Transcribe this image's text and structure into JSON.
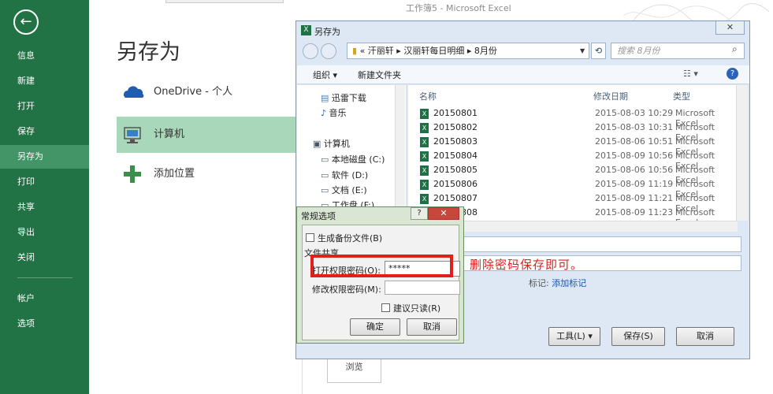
{
  "window_title": "工作簿5 - Microsoft Excel",
  "backstage": {
    "back_arrow": "←",
    "nav": [
      "信息",
      "新建",
      "打开",
      "保存",
      "另存为",
      "打印",
      "共享",
      "导出",
      "关闭",
      "帐户",
      "选项"
    ],
    "active_nav": "另存为",
    "heading": "另存为",
    "places": [
      "OneDrive - 个人",
      "计算机",
      "添加位置"
    ],
    "selected_place": "计算机",
    "browse": "浏览"
  },
  "save_dialog": {
    "title": "另存为",
    "close": "✕",
    "address": [
      "«",
      "汗丽轩",
      "▸",
      "汉丽轩每日明细",
      "▸",
      "8月份"
    ],
    "search_placeholder": "搜索 8月份",
    "organize": "组织 ▾",
    "new_folder": "新建文件夹",
    "view_icon": "☷ ▾",
    "help": "?",
    "tree": [
      "迅雷下载",
      "音乐",
      "计算机",
      "本地磁盘 (C:)",
      "软件 (D:)",
      "文档 (E:)",
      "工作盘 (F:)"
    ],
    "columns": [
      "名称",
      "修改日期",
      "类型"
    ],
    "files": [
      {
        "name": "20150801",
        "date": "2015-08-03 10:29",
        "type": "Microsoft Excel"
      },
      {
        "name": "20150802",
        "date": "2015-08-03 10:31",
        "type": "Microsoft Excel"
      },
      {
        "name": "20150803",
        "date": "2015-08-06 10:51",
        "type": "Microsoft Excel"
      },
      {
        "name": "20150804",
        "date": "2015-08-09 10:56",
        "type": "Microsoft Excel"
      },
      {
        "name": "20150805",
        "date": "2015-08-06 10:56",
        "type": "Microsoft Excel"
      },
      {
        "name": "20150806",
        "date": "2015-08-09 11:19",
        "type": "Microsoft Excel"
      },
      {
        "name": "20150807",
        "date": "2015-08-09 11:21",
        "type": "Microsoft Excel"
      },
      {
        "name": "20150808",
        "date": "2015-08-09 11:23",
        "type": "Microsoft Excel"
      }
    ],
    "annotation": "删除密码保存即可。",
    "tags_label": "标记:",
    "tags_link": "添加标记",
    "tools": "工具(L)",
    "save": "保存(S)",
    "cancel": "取消"
  },
  "general_options": {
    "title": "常规选项",
    "help": "?",
    "close": "✕",
    "backup": "生成备份文件(B)",
    "file_sharing": "文件共享",
    "open_password_label": "打开权限密码(O):",
    "open_password_value": "*****",
    "modify_password_label": "修改权限密码(M):",
    "read_only": "建议只读(R)",
    "ok": "确定",
    "cancel": "取消"
  },
  "colors": {
    "sidebar": "#217346",
    "sidebar_active": "#439467",
    "place_selected": "#a9d7ba",
    "highlight": "#e0201c"
  }
}
